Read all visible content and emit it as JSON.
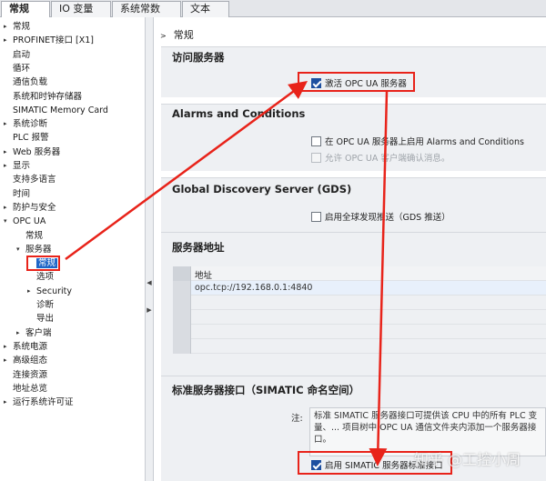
{
  "tabs": [
    {
      "label": "常规",
      "active": true
    },
    {
      "label": "IO 变量",
      "active": false
    },
    {
      "label": "系统常数",
      "active": false
    },
    {
      "label": "文本",
      "active": false
    }
  ],
  "tree": [
    {
      "label": "常规",
      "arrow": "▸",
      "level": 0
    },
    {
      "label": "PROFINET接口 [X1]",
      "arrow": "▸",
      "level": 0
    },
    {
      "label": "启动",
      "arrow": "",
      "level": 0
    },
    {
      "label": "循环",
      "arrow": "",
      "level": 0
    },
    {
      "label": "通信负载",
      "arrow": "",
      "level": 0
    },
    {
      "label": "系统和时钟存储器",
      "arrow": "",
      "level": 0
    },
    {
      "label": "SIMATIC Memory Card",
      "arrow": "",
      "level": 0
    },
    {
      "label": "系统诊断",
      "arrow": "▸",
      "level": 0
    },
    {
      "label": "PLC 报警",
      "arrow": "",
      "level": 0
    },
    {
      "label": "Web 服务器",
      "arrow": "▸",
      "level": 0
    },
    {
      "label": "显示",
      "arrow": "▸",
      "level": 0
    },
    {
      "label": "支持多语言",
      "arrow": "",
      "level": 0
    },
    {
      "label": "时间",
      "arrow": "",
      "level": 0
    },
    {
      "label": "防护与安全",
      "arrow": "▸",
      "level": 0
    },
    {
      "label": "OPC UA",
      "arrow": "▾",
      "level": 0
    },
    {
      "label": "常规",
      "arrow": "",
      "level": 1
    },
    {
      "label": "服务器",
      "arrow": "▾",
      "level": 1
    },
    {
      "label": "常规",
      "arrow": "",
      "level": 2,
      "selected": true
    },
    {
      "label": "选项",
      "arrow": "",
      "level": 2
    },
    {
      "label": "Security",
      "arrow": "▸",
      "level": 2
    },
    {
      "label": "诊断",
      "arrow": "",
      "level": 2
    },
    {
      "label": "导出",
      "arrow": "",
      "level": 2
    },
    {
      "label": "客户端",
      "arrow": "▸",
      "level": 1
    },
    {
      "label": "系统电源",
      "arrow": "▸",
      "level": 0
    },
    {
      "label": "高级组态",
      "arrow": "▸",
      "level": 0
    },
    {
      "label": "连接资源",
      "arrow": "",
      "level": 0
    },
    {
      "label": "地址总览",
      "arrow": "",
      "level": 0
    },
    {
      "label": "运行系统许可证",
      "arrow": "▸",
      "level": 0
    }
  ],
  "breadcrumb": "常规",
  "sections": {
    "access": {
      "title": "访问服务器",
      "activate_label": "激活 OPC UA 服务器",
      "activate_checked": true
    },
    "alarms": {
      "title": "Alarms and Conditions",
      "enable_label": "在 OPC UA 服务器上启用 Alarms and Conditions",
      "enable_checked": false,
      "ack_label": "允许 OPC UA 客户端确认消息。",
      "ack_checked": false
    },
    "gds": {
      "title": "Global Discovery Server (GDS)",
      "push_label": "启用全球发现推送（GDS 推送）",
      "push_checked": false
    },
    "address": {
      "title": "服务器地址",
      "column": "地址",
      "rows": [
        "opc.tcp://192.168.0.1:4840"
      ]
    },
    "standard": {
      "title": "标准服务器接口（SIMATIC 命名空间）",
      "note_label": "注:",
      "note_text": "标准 SIMATIC 服务器接口可提供该 CPU 中的所有 PLC 变量、... 项目树中 OPC UA 通信文件夹内添加一个服务器接口。",
      "enable_label": "启用 SIMATIC 服务器标准接口",
      "enable_checked": true
    }
  },
  "watermark": "知乎 @工控小周",
  "colors": {
    "annotation": "#e8231a",
    "selection": "#1e66c8",
    "checkbox": "#1d4fa0"
  }
}
